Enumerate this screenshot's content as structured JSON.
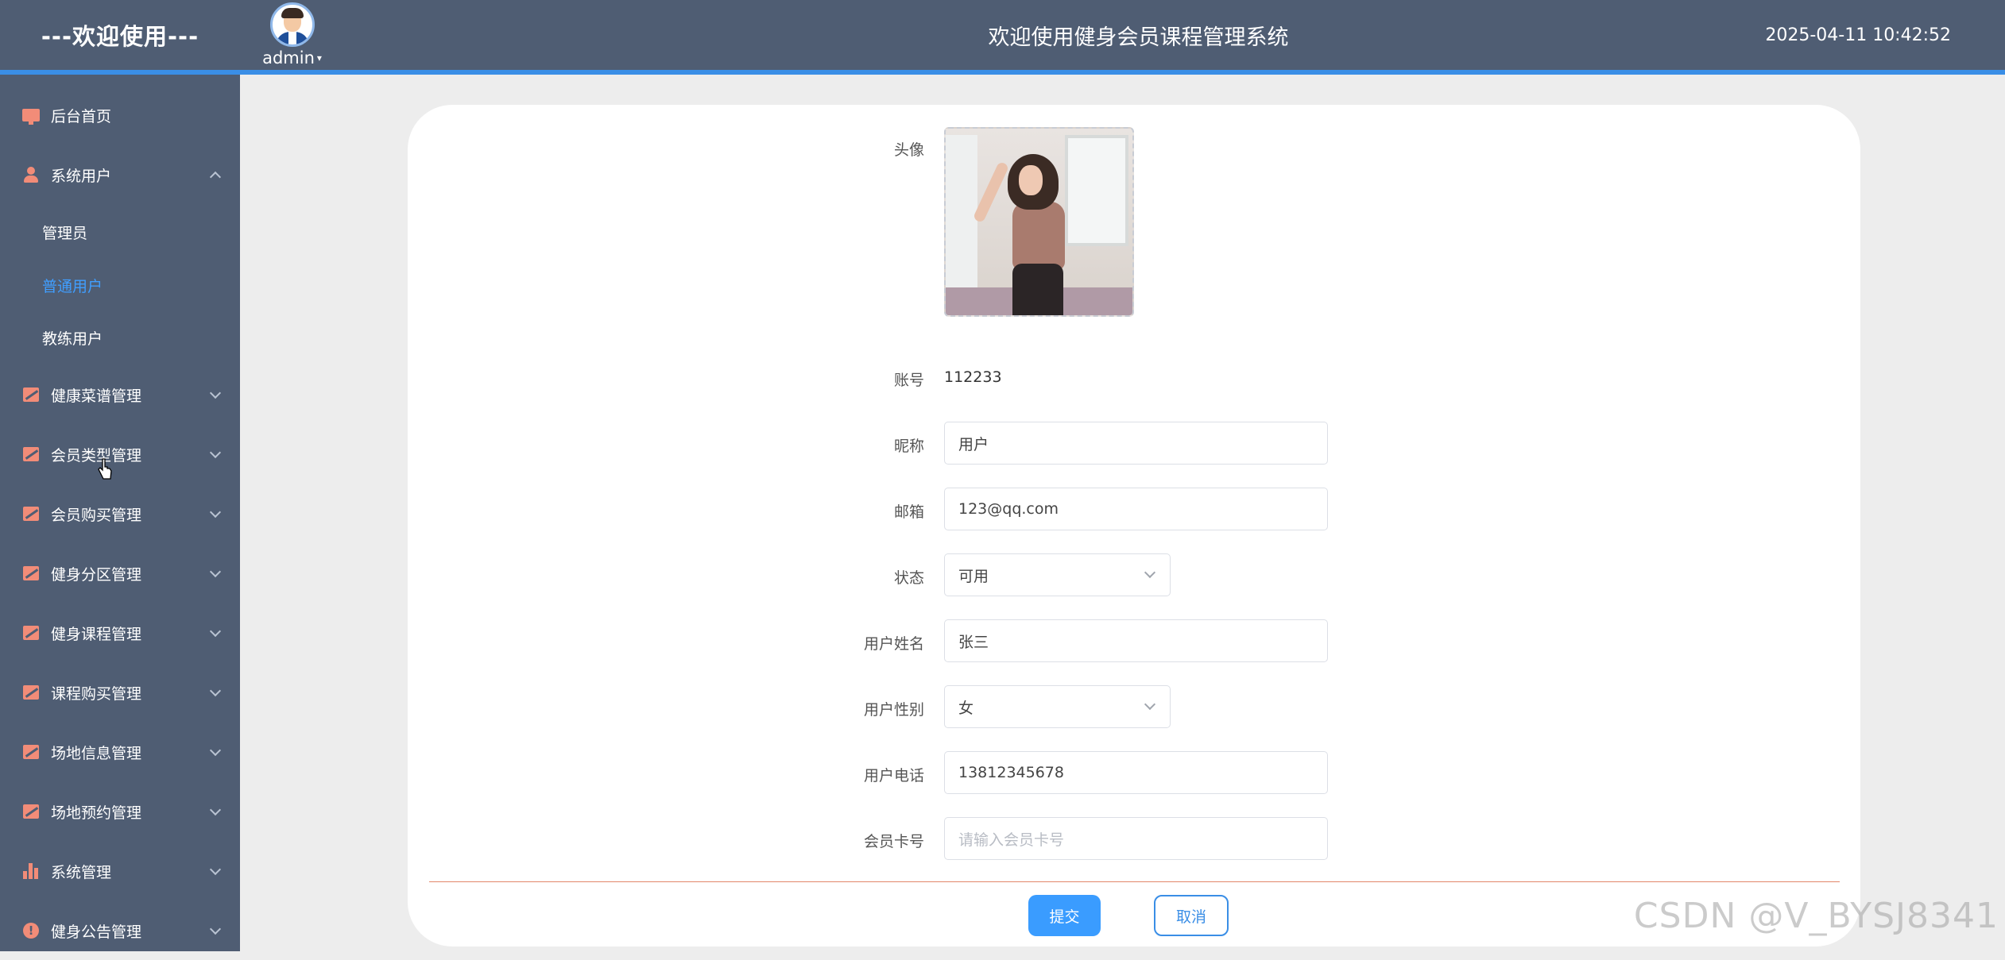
{
  "header": {
    "brand": "---欢迎使用---",
    "username": "admin",
    "system_title": "欢迎使用健身会员课程管理系统",
    "datetime": "2025-04-11 10:42:52"
  },
  "sidebar": {
    "items": [
      {
        "label": "后台首页",
        "icon": "monitor-icon"
      },
      {
        "label": "系统用户",
        "icon": "user-icon",
        "expanded": true,
        "children": [
          {
            "label": "管理员",
            "active": false
          },
          {
            "label": "普通用户",
            "active": true
          },
          {
            "label": "教练用户",
            "active": false
          }
        ]
      },
      {
        "label": "健康菜谱管理",
        "icon": "chart-icon"
      },
      {
        "label": "会员类型管理",
        "icon": "chart-icon"
      },
      {
        "label": "会员购买管理",
        "icon": "chart-icon"
      },
      {
        "label": "健身分区管理",
        "icon": "chart-icon"
      },
      {
        "label": "健身课程管理",
        "icon": "chart-icon"
      },
      {
        "label": "课程购买管理",
        "icon": "chart-icon"
      },
      {
        "label": "场地信息管理",
        "icon": "chart-icon"
      },
      {
        "label": "场地预约管理",
        "icon": "chart-icon"
      },
      {
        "label": "系统管理",
        "icon": "bar-chart-icon"
      },
      {
        "label": "健身公告管理",
        "icon": "info-icon"
      }
    ]
  },
  "form": {
    "avatar_label": "头像",
    "account_label": "账号",
    "account_value": "112233",
    "nickname_label": "昵称",
    "nickname_value": "用户",
    "email_label": "邮箱",
    "email_value": "123@qq.com",
    "status_label": "状态",
    "status_value": "可用",
    "name_label": "用户姓名",
    "name_value": "张三",
    "gender_label": "用户性别",
    "gender_value": "女",
    "phone_label": "用户电话",
    "phone_value": "13812345678",
    "card_label": "会员卡号",
    "card_placeholder": "请输入会员卡号",
    "submit_label": "提交",
    "cancel_label": "取消"
  },
  "watermark": "CSDN @V_BYSJ8341",
  "colors": {
    "header_bg": "#4f5d73",
    "accent": "#3a8ee6",
    "primary_button": "#3a9cff",
    "icon_color": "#f28c78"
  }
}
